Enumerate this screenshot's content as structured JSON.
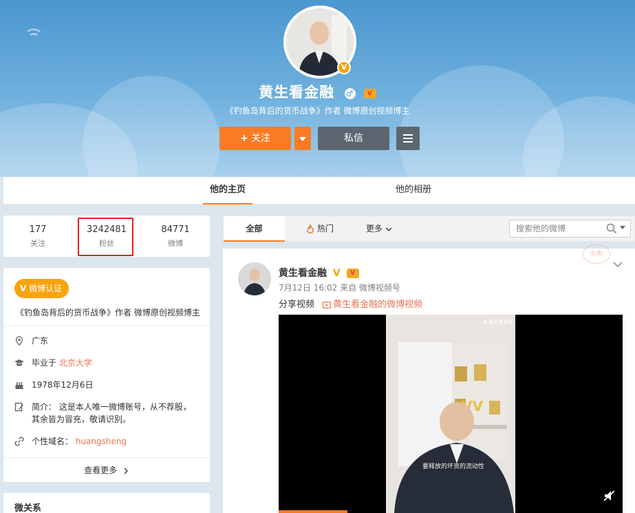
{
  "profile": {
    "name": "黄生看金融",
    "bio": "《钓鱼岛背后的货币战争》作者 微博原创视频博主",
    "verified_badge": "V",
    "gender_icon": "male-icon",
    "vip_icon": "vip-icon"
  },
  "actions": {
    "follow_label": "关注",
    "message_label": "私信"
  },
  "main_tabs": [
    {
      "label": "他的主页",
      "active": true
    },
    {
      "label": "他的相册",
      "active": false
    }
  ],
  "stats": [
    {
      "value": "177",
      "label": "关注"
    },
    {
      "value": "3242481",
      "label": "粉丝",
      "highlighted": true
    },
    {
      "value": "84771",
      "label": "微博"
    }
  ],
  "info": {
    "verified_tag": "微博认证",
    "verified_mark": "V",
    "description": "《钓鱼岛背后的货币战争》作者 微博原创视频博主",
    "location": "广东",
    "education_prefix": "毕业于",
    "education_school": "北京大学",
    "birthday": "1978年12月6日",
    "intro_prefix": "简介：",
    "intro_line1": "这是本人唯一微博账号，从不荐股，",
    "intro_line2": "其余皆为冒充，敬请识别。",
    "domain_label": "个性域名：",
    "domain_value": "huangsheng",
    "more_label": "查看更多"
  },
  "relation": {
    "title": "微关系"
  },
  "feed_tabs": [
    {
      "label": "全部",
      "active": true
    },
    {
      "label": "热门",
      "active": false
    },
    {
      "label": "更多",
      "active": false
    }
  ],
  "search": {
    "placeholder": "搜索他的微博"
  },
  "post": {
    "author": "黄生看金融",
    "meta": "7月12日 16:02 来自 微博视频号",
    "text": "分享视频",
    "video_link": "黄生看金融的微博视频",
    "video_subtitle": "要释放的坏资的流动性",
    "video_watermark": "◉ 黄生看金融",
    "stamp_text": "头条"
  },
  "colors": {
    "accent": "#f97c24",
    "dark_button": "#5d6670",
    "link": "#eb7350",
    "verified": "#f9a30e",
    "highlight": "#e21f1f"
  }
}
